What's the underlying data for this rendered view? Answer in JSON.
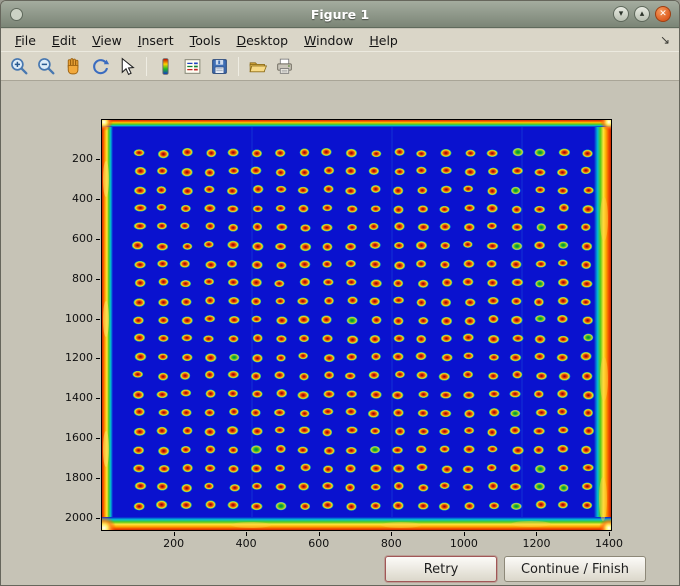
{
  "window": {
    "title": "Figure 1",
    "controls": [
      {
        "name": "minimize-button",
        "glyph": "▾"
      },
      {
        "name": "maximize-button",
        "glyph": "▴"
      },
      {
        "name": "close-button",
        "glyph": "✕"
      }
    ]
  },
  "menu": {
    "items": [
      "File",
      "Edit",
      "View",
      "Insert",
      "Tools",
      "Desktop",
      "Window",
      "Help"
    ],
    "dock_glyph": "↘"
  },
  "toolbar": {
    "groups": [
      [
        "zoom-in-icon",
        "zoom-out-icon",
        "pan-icon",
        "rotate-3d-icon",
        "data-cursor-icon"
      ],
      [
        "insert-colorbar-icon",
        "insert-legend-icon",
        "save-icon"
      ],
      [
        "open-folder-icon",
        "print-icon"
      ]
    ]
  },
  "plot": {
    "x_ticks": [
      200,
      400,
      600,
      800,
      1000,
      1200,
      1400
    ],
    "y_ticks": [
      200,
      400,
      600,
      800,
      1000,
      1200,
      1400,
      1600,
      1800,
      2000
    ]
  },
  "chart_data": {
    "type": "heatmap",
    "title": "",
    "xlabel": "",
    "ylabel": "",
    "x_range": [
      0,
      1430
    ],
    "y_range": [
      0,
      2065
    ],
    "x_ticks": [
      200,
      400,
      600,
      800,
      1000,
      1200,
      1400
    ],
    "y_ticks": [
      200,
      400,
      600,
      800,
      1000,
      1200,
      1400,
      1600,
      1800,
      2000
    ],
    "colormap": "jet",
    "description": "Scanned plate/array image: ~20 x 20 grid of high-intensity red/orange spots on a blue low-intensity background, saturated red/yellow edge artifacts on all four borders",
    "grid": {
      "cols": 20,
      "rows": 20,
      "x_start": 105,
      "x_step": 65,
      "y_start": 170,
      "y_step": 93
    }
  },
  "buttons": [
    {
      "name": "retry-button",
      "label": "Retry"
    },
    {
      "name": "continue-finish-button",
      "label": "Continue / Finish"
    }
  ],
  "colors": {
    "titlebar": "#8d968a",
    "chrome": "#dad6c8",
    "canvas": "#c6c3b6",
    "image_bg": "#0a12cf",
    "close_button": "#dd5c20"
  }
}
